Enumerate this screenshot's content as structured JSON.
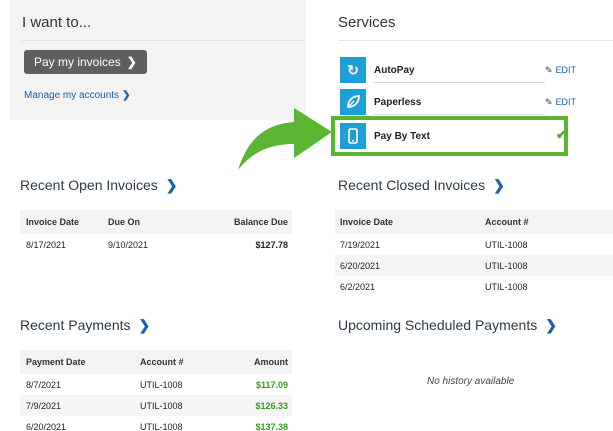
{
  "want": {
    "heading": "I want to...",
    "pay_button": "Pay my invoices",
    "manage_link": "Manage my accounts"
  },
  "services": {
    "heading": "Services",
    "items": [
      {
        "label": "AutoPay",
        "action": "EDIT",
        "icon": "refresh-icon"
      },
      {
        "label": "Paperless",
        "action": "EDIT",
        "icon": "leaf-icon"
      },
      {
        "label": "Pay By Text",
        "action": "",
        "icon": "phone-icon"
      }
    ],
    "highlight_color": "#5ab632",
    "icon_color": "#1e9fd6"
  },
  "open_invoices": {
    "title": "Recent Open Invoices",
    "headers": [
      "Invoice Date",
      "Due On",
      "Balance Due"
    ],
    "rows": [
      [
        "8/17/2021",
        "9/10/2021",
        "$127.78"
      ]
    ]
  },
  "closed_invoices": {
    "title": "Recent Closed Invoices",
    "headers": [
      "Invoice Date",
      "Account #"
    ],
    "rows": [
      [
        "7/19/2021",
        "UTIL-1008"
      ],
      [
        "6/20/2021",
        "UTIL-1008"
      ],
      [
        "6/2/2021",
        "UTIL-1008"
      ]
    ]
  },
  "payments": {
    "title": "Recent Payments",
    "headers": [
      "Payment Date",
      "Account #",
      "Amount"
    ],
    "rows": [
      [
        "8/7/2021",
        "UTIL-1008",
        "$117.09"
      ],
      [
        "7/9/2021",
        "UTIL-1008",
        "$126.33"
      ],
      [
        "6/20/2021",
        "UTIL-1008",
        "$137.38"
      ]
    ]
  },
  "scheduled": {
    "title": "Upcoming Scheduled Payments",
    "empty_text": "No history available"
  }
}
